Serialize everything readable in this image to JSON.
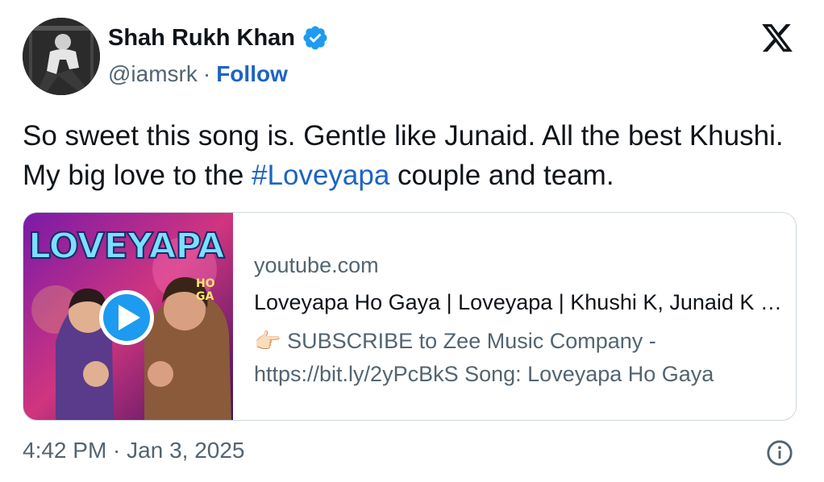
{
  "author": {
    "name": "Shah Rukh Khan",
    "handle": "@iamsrk",
    "separator": "·",
    "follow_label": "Follow",
    "verified_icon": "verified-badge-icon",
    "avatar": "profile-photo"
  },
  "brand": {
    "logo_icon": "x-logo-icon"
  },
  "tweet": {
    "text_before": "So sweet this song is. Gentle like Junaid. All the best Khushi. My big love to the ",
    "hashtag": "#Loveyapa",
    "text_after": " couple and team."
  },
  "card": {
    "thumbnail_title": "LOVEYAPA",
    "thumbnail_subtitle": "HO GA",
    "play_icon": "play-icon",
    "domain": "youtube.com",
    "title": "Loveyapa Ho Gaya | Loveyapa | Khushi K, Junaid K | Zee Music",
    "description_line1": "👉🏻 SUBSCRIBE to Zee Music Company -",
    "description_line2": "https://bit.ly/2yPcBkS Song: Loveyapa Ho Gaya"
  },
  "footer": {
    "timestamp": "4:42 PM · Jan 3, 2025",
    "info_icon": "info-icon"
  },
  "colors": {
    "link": "#1d64c3",
    "text": "#0f1419",
    "muted": "#536471",
    "verified": "#1d9bf0",
    "border": "#cfd9de"
  }
}
